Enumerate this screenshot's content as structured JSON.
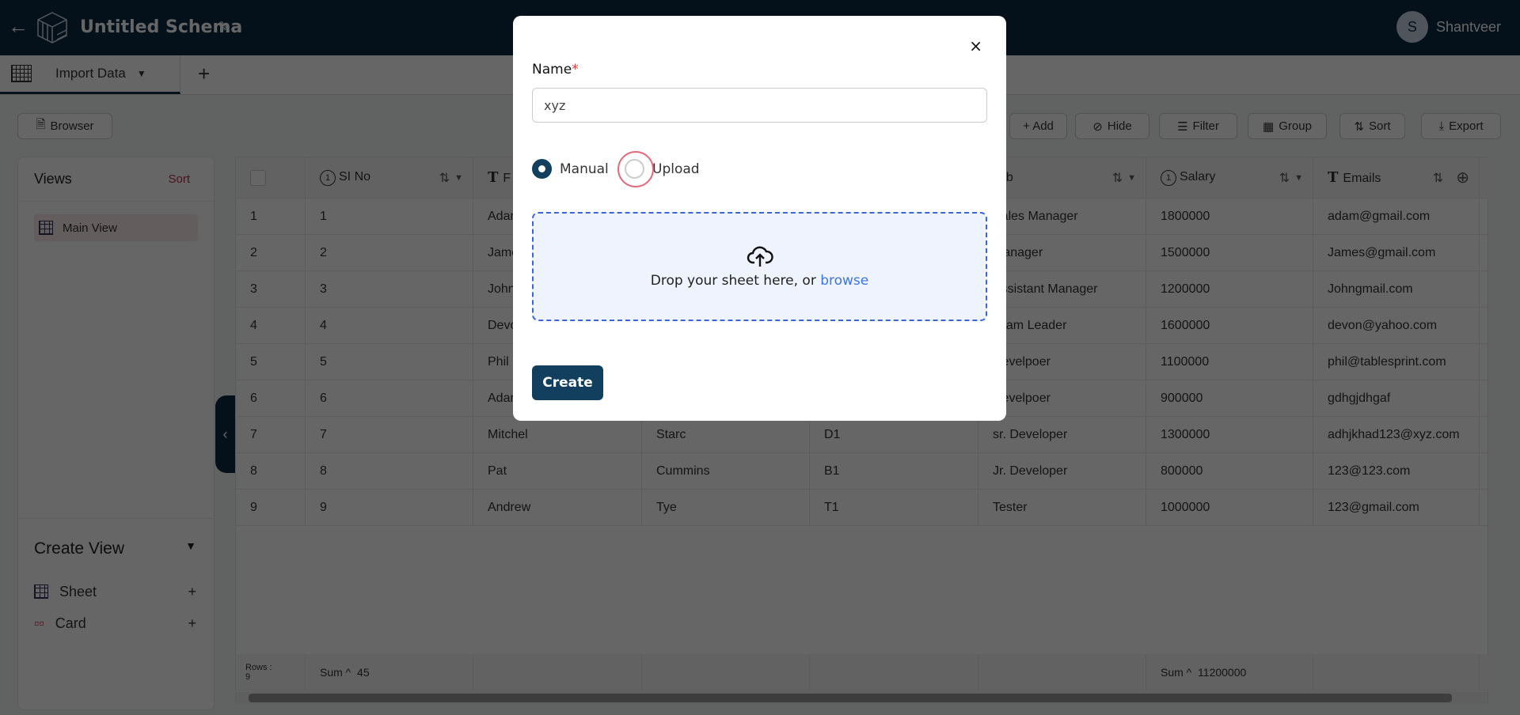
{
  "header": {
    "title": "Untitled Schema",
    "user_initial": "S",
    "user_name": "Shantveer"
  },
  "tabs": [
    {
      "label": "Import Data"
    }
  ],
  "toolbar": {
    "browser": "Browser",
    "add": "+ Add",
    "hide": "Hide",
    "filter": "Filter",
    "group": "Group",
    "sort": "Sort",
    "export": "Export"
  },
  "views": {
    "title": "Views",
    "sort": "Sort",
    "items": [
      {
        "label": "Main View"
      }
    ],
    "create_title": "Create View",
    "create_items": [
      {
        "label": "Sheet"
      },
      {
        "label": "Card"
      }
    ]
  },
  "table": {
    "columns": [
      {
        "label": ""
      },
      {
        "label": "SI No",
        "type": "number"
      },
      {
        "label": "F",
        "type": "text"
      },
      {
        "label": "",
        "type": ""
      },
      {
        "label": "",
        "type": ""
      },
      {
        "label": "Job",
        "type": ""
      },
      {
        "label": "Salary",
        "type": "number"
      },
      {
        "label": "Emails",
        "type": "text"
      }
    ],
    "rows": [
      [
        "1",
        "1",
        "Adam",
        "",
        "",
        "Sales Manager",
        "1800000",
        "adam@gmail.com"
      ],
      [
        "2",
        "2",
        "James",
        "",
        "",
        "Manager",
        "1500000",
        "James@gmail.com"
      ],
      [
        "3",
        "3",
        "John",
        "",
        "",
        "Assistant Manager",
        "1200000",
        "Johngmail.com"
      ],
      [
        "4",
        "4",
        "Devon",
        "",
        "",
        "Team Leader",
        "1600000",
        "devon@yahoo.com"
      ],
      [
        "5",
        "5",
        "Phil",
        "",
        "",
        "Develpoer",
        "1100000",
        "phil@tablesprint.com"
      ],
      [
        "6",
        "6",
        "Adam",
        "",
        "",
        "Develpoer",
        "900000",
        "gdhgjdhgaf"
      ],
      [
        "7",
        "7",
        "Mitchel",
        "Starc",
        "D1",
        "sr. Developer",
        "1300000",
        "adhjkhad123@xyz.com"
      ],
      [
        "8",
        "8",
        "Pat",
        "Cummins",
        "B1",
        "Jr. Developer",
        "800000",
        "123@123.com"
      ],
      [
        "9",
        "9",
        "Andrew",
        "Tye",
        "T1",
        "Tester",
        "1000000",
        "123@gmail.com"
      ]
    ],
    "footer": {
      "rows_label": "Rows :",
      "rows_count": "9",
      "sum_label": "Sum ^",
      "sino_sum": "45",
      "salary_sum": "11200000"
    }
  },
  "modal": {
    "name_label": "Name",
    "required": "*",
    "name_value": "xyz",
    "radio_manual": "Manual",
    "radio_upload": "Upload",
    "selected": "Manual",
    "drop_text": "Drop your sheet here, or ",
    "browse": "browse",
    "create": "Create",
    "close": "×"
  },
  "colors": {
    "primary": "#133f5e",
    "accent_link": "#3b75e0",
    "sort_link": "#b3324d"
  }
}
